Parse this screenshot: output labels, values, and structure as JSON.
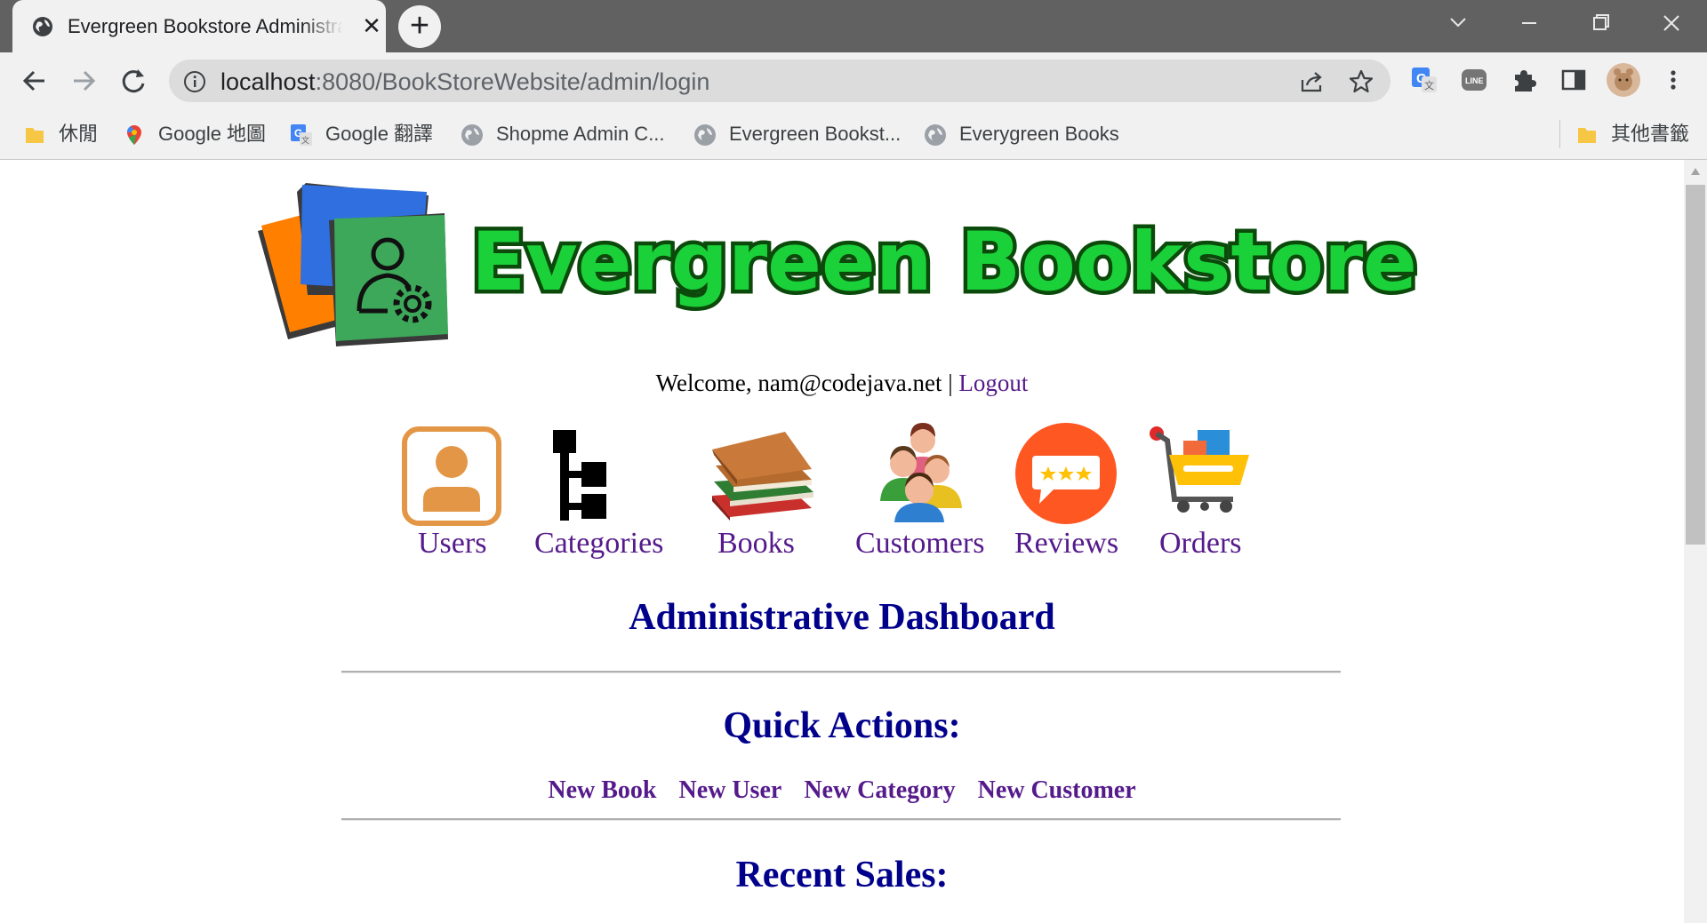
{
  "browser": {
    "tab_title": "Evergreen Bookstore Administration",
    "tab_close": "✕",
    "new_tab": "+",
    "url_host": "localhost",
    "url_rest": ":8080/BookStoreWebsite/admin/login",
    "bookmarks": [
      {
        "label": "休閒",
        "icon": "folder-icon"
      },
      {
        "label": "Google 地圖",
        "icon": "google-maps-icon"
      },
      {
        "label": "Google 翻譯",
        "icon": "google-translate-icon"
      },
      {
        "label": "Shopme Admin C...",
        "icon": "globe-icon"
      },
      {
        "label": "Evergreen Bookst...",
        "icon": "globe-icon"
      },
      {
        "label": "Everygreen Books",
        "icon": "globe-icon"
      }
    ],
    "other_bookmarks": "其他書籤"
  },
  "logo": {
    "text": "Evergreen Bookstore"
  },
  "header": {
    "welcome_prefix": "Welcome, nam@codejava.net",
    "separator": "|",
    "logout": "Logout"
  },
  "menu": [
    {
      "label": "Users",
      "icon": "user-icon"
    },
    {
      "label": "Categories",
      "icon": "tree-icon"
    },
    {
      "label": "Books",
      "icon": "books-icon"
    },
    {
      "label": "Customers",
      "icon": "customers-icon"
    },
    {
      "label": "Reviews",
      "icon": "reviews-icon"
    },
    {
      "label": "Orders",
      "icon": "cart-icon"
    }
  ],
  "dashboard": {
    "title": "Administrative Dashboard",
    "quick_actions_title": "Quick Actions:",
    "quick_actions": [
      "New Book",
      "New User",
      "New Category",
      "New Customer"
    ],
    "recent_sales_title": "Recent Sales:"
  },
  "colors": {
    "link": "#551a8b",
    "heading": "#00008b",
    "logo_green": "#1ad13a",
    "logo_outline": "#0b4a0b"
  }
}
